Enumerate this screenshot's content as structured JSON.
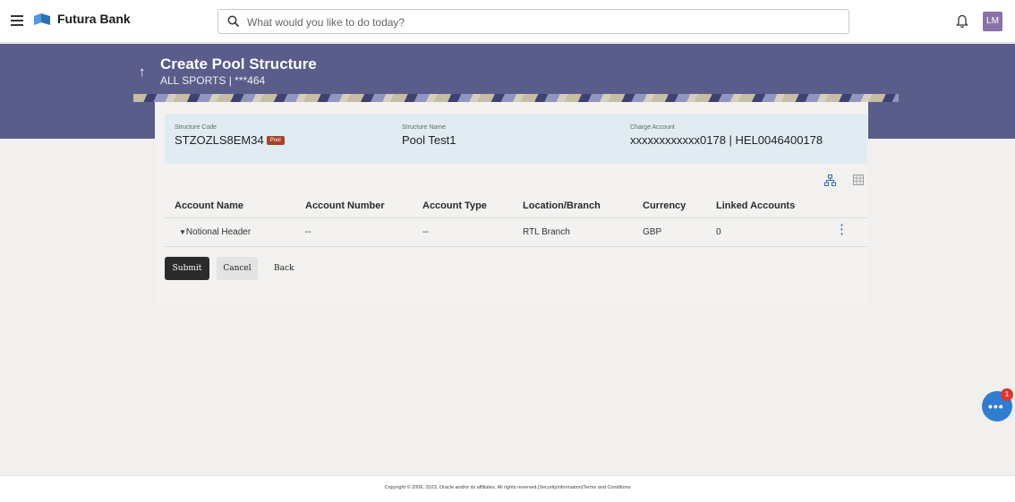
{
  "header": {
    "brand": "Futura Bank",
    "search_placeholder": "What would you like to do today?",
    "avatar_initials": "LM"
  },
  "page": {
    "title": "Create Pool Structure",
    "subtitle": "ALL SPORTS | ***464"
  },
  "structure": {
    "code_label": "Structure Code",
    "code_value": "STZOZLS8EM34",
    "badge": "Pool",
    "name_label": "Structure Name",
    "name_value": "Pool Test1",
    "charge_label": "Charge Account",
    "charge_value": "xxxxxxxxxxxx0178 | HEL0046400178"
  },
  "table": {
    "columns": [
      "Account Name",
      "Account Number",
      "Account Type",
      "Location/Branch",
      "Currency",
      "Linked Accounts"
    ],
    "rows": [
      {
        "account_name": "Notional Header",
        "account_number": "--",
        "account_type": "--",
        "location": "RTL Branch",
        "currency": "GBP",
        "linked": "0"
      }
    ]
  },
  "actions": {
    "submit": "Submit",
    "cancel": "Cancel",
    "back": "Back"
  },
  "footer": {
    "text": "Copyright © 2006, 2023, Oracle and/or its affiliates. All rights reserved.|SecurityInformation|Terms and Conditions"
  },
  "chat": {
    "badge_count": "1"
  }
}
